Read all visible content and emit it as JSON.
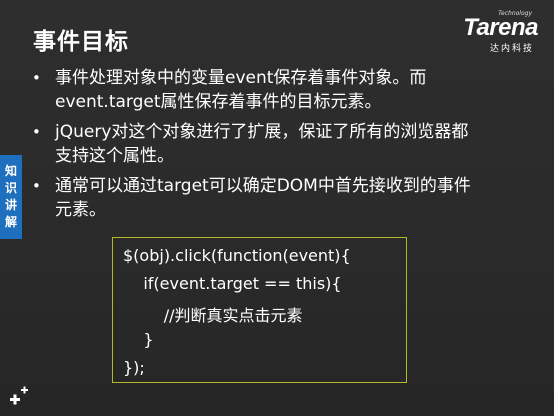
{
  "slide": {
    "title": "事件目标",
    "logo": {
      "small_text": "Technology",
      "name": "Tarena",
      "subtitle": "达内科技"
    },
    "side_tab": [
      "知",
      "识",
      "讲",
      "解"
    ],
    "bullets": [
      {
        "line1": "事件处理对象中的变量event保存着事件对象。而",
        "line2": "event.target属性保存着事件的目标元素。"
      },
      {
        "line1": "jQuery对这个对象进行了扩展，保证了所有的浏览器都",
        "line2": "支持这个属性。"
      },
      {
        "line1": "通常可以通过target可以确定DOM中首先接收到的事件",
        "line2": "元素。"
      }
    ],
    "bullet_symbol": "•",
    "code": [
      "$(obj).click(function(event){",
      "    if(event.target == this){",
      "        //判断真实点击元素",
      "    }",
      "});"
    ],
    "colors": {
      "background": "#2b2b2b",
      "side_tab": "#1f6fbf",
      "code_border": "#b5b82a",
      "text": "#ffffff"
    },
    "decorative_icon": "plus-cross-icon"
  }
}
